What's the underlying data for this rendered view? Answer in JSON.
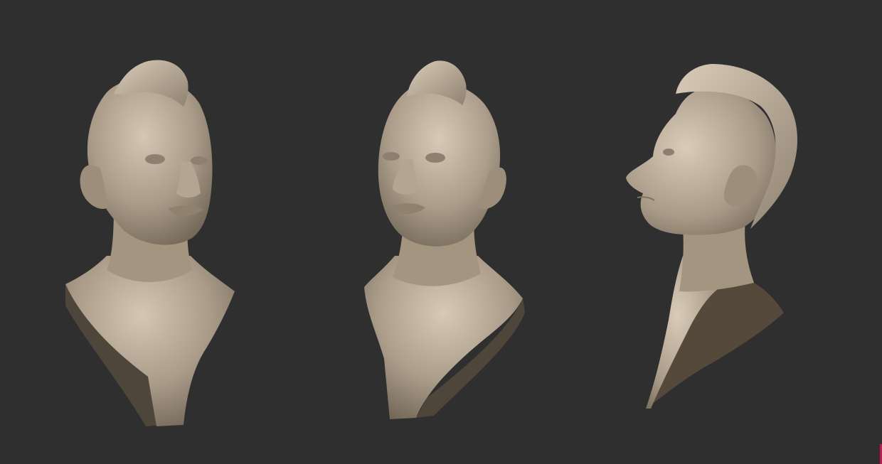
{
  "scene": {
    "background_color": "#2f2f2f",
    "material_color": "#a89a87",
    "material_highlight": "#cfc2af",
    "material_shadow": "#5e5448",
    "accent_color": "#c2184f",
    "busts": [
      {
        "name": "bust-three-quarter-right"
      },
      {
        "name": "bust-three-quarter-left"
      },
      {
        "name": "bust-profile-left"
      }
    ]
  }
}
